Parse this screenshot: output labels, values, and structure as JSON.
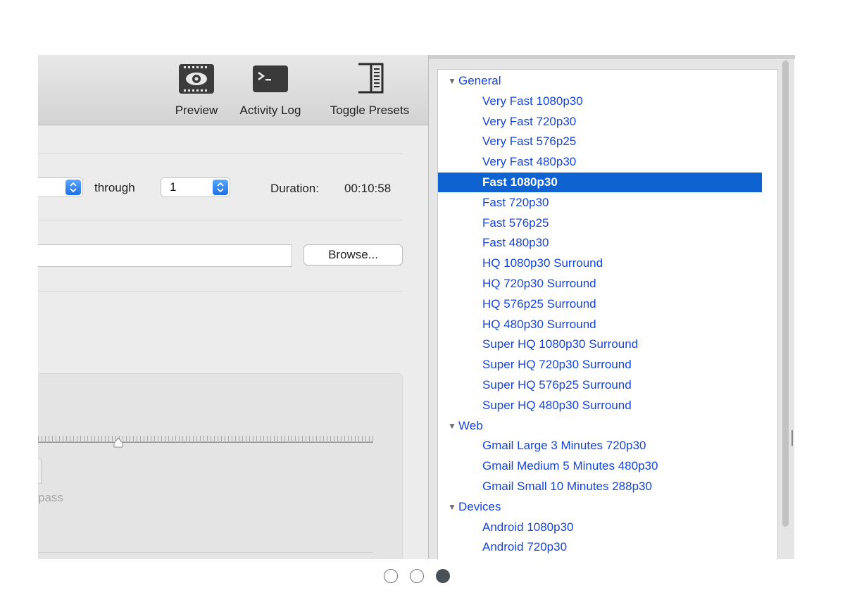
{
  "toolbar": {
    "preview_label": "Preview",
    "activity_log_label": "Activity Log",
    "toggle_presets_label": "Toggle Presets"
  },
  "range": {
    "through_label": "through",
    "end_value": "1",
    "duration_label": "Duration:",
    "duration_value": "00:10:58"
  },
  "destination": {
    "browse_label": "Browse..."
  },
  "quality": {
    "pass_label": "pass",
    "slider_level": 0.24
  },
  "presets": {
    "rows": [
      {
        "type": "group",
        "label": "General"
      },
      {
        "type": "preset",
        "label": "Very Fast 1080p30"
      },
      {
        "type": "preset",
        "label": "Very Fast 720p30"
      },
      {
        "type": "preset",
        "label": "Very Fast 576p25"
      },
      {
        "type": "preset",
        "label": "Very Fast 480p30"
      },
      {
        "type": "preset",
        "label": "Fast 1080p30",
        "selected": true
      },
      {
        "type": "preset",
        "label": "Fast 720p30"
      },
      {
        "type": "preset",
        "label": "Fast 576p25"
      },
      {
        "type": "preset",
        "label": "Fast 480p30"
      },
      {
        "type": "preset",
        "label": "HQ 1080p30 Surround"
      },
      {
        "type": "preset",
        "label": "HQ 720p30 Surround"
      },
      {
        "type": "preset",
        "label": "HQ 576p25 Surround"
      },
      {
        "type": "preset",
        "label": "HQ 480p30 Surround"
      },
      {
        "type": "preset",
        "label": "Super HQ 1080p30 Surround"
      },
      {
        "type": "preset",
        "label": "Super HQ 720p30 Surround"
      },
      {
        "type": "preset",
        "label": "Super HQ 576p25 Surround"
      },
      {
        "type": "preset",
        "label": "Super HQ 480p30 Surround"
      },
      {
        "type": "group",
        "label": "Web"
      },
      {
        "type": "preset",
        "label": "Gmail Large 3 Minutes 720p30"
      },
      {
        "type": "preset",
        "label": "Gmail Medium 5 Minutes 480p30"
      },
      {
        "type": "preset",
        "label": "Gmail Small 10 Minutes 288p30"
      },
      {
        "type": "group",
        "label": "Devices"
      },
      {
        "type": "preset",
        "label": "Android 1080p30"
      },
      {
        "type": "preset",
        "label": "Android 720p30"
      }
    ]
  },
  "carousel": {
    "dot_count": 3,
    "active_index": 2
  },
  "colors": {
    "selection": "#0f63d1",
    "preset_text": "#1745d4"
  }
}
